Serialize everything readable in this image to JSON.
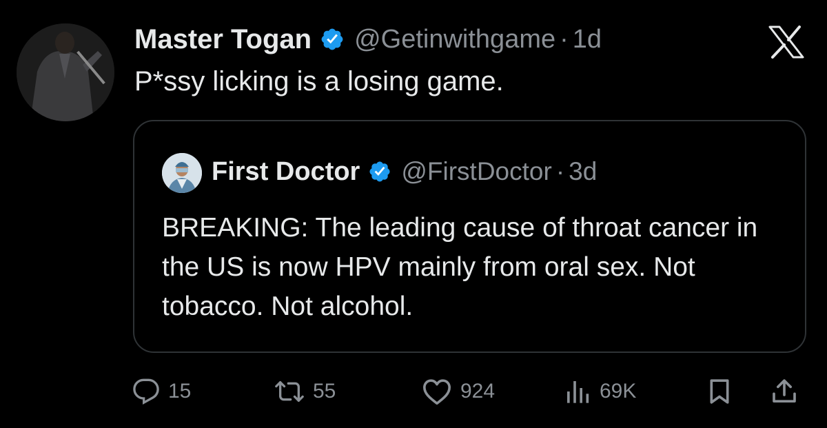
{
  "tweet": {
    "display_name": "Master Togan",
    "handle": "@Getinwithgame",
    "separator": "·",
    "time": "1d",
    "text": "P*ssy licking is a losing game.",
    "avatar_icon": "profile-photo-man-in-suit",
    "verified_icon": "verified-badge-icon",
    "verified_color": "#1d9bf0"
  },
  "quote": {
    "display_name": "First Doctor",
    "handle": "@FirstDoctor",
    "separator": "·",
    "time": "3d",
    "text": "BREAKING: The leading cause of throat cancer in the US is now HPV mainly from oral sex. Not tobacco. Not alcohol.",
    "avatar_icon": "profile-photo-doctor",
    "verified_icon": "verified-badge-icon"
  },
  "logo": {
    "icon": "x-logo-icon"
  },
  "actions": {
    "reply": {
      "icon": "reply-icon",
      "count": "15"
    },
    "retweet": {
      "icon": "retweet-icon",
      "count": "55"
    },
    "like": {
      "icon": "heart-icon",
      "count": "924"
    },
    "views": {
      "icon": "views-icon",
      "count": "69K"
    },
    "bookmark": {
      "icon": "bookmark-icon"
    },
    "share": {
      "icon": "share-icon"
    }
  },
  "colors": {
    "background": "#000000",
    "text_primary": "#e7e9ea",
    "text_secondary": "#8b9096",
    "border": "#2f3336",
    "verified": "#1d9bf0"
  }
}
